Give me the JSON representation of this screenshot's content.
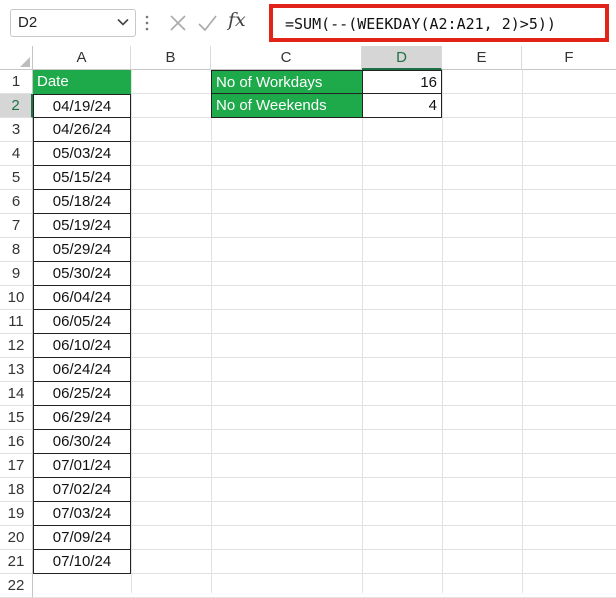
{
  "formula_bar": {
    "name_box": "D2",
    "fx_label": "fx",
    "formula": "=SUM(--(WEEKDAY(A2:A21, 2)>5))"
  },
  "columns": [
    "A",
    "B",
    "C",
    "D",
    "E",
    "F"
  ],
  "selected_column": "D",
  "rows": [
    "1",
    "2",
    "3",
    "4",
    "5",
    "6",
    "7",
    "8",
    "9",
    "10",
    "11",
    "12",
    "13",
    "14",
    "15",
    "16",
    "17",
    "18",
    "19",
    "20",
    "21",
    "22"
  ],
  "selected_row": "2",
  "column_a": {
    "header": "Date",
    "dates": [
      "04/19/24",
      "04/26/24",
      "05/03/24",
      "05/15/24",
      "05/18/24",
      "05/19/24",
      "05/29/24",
      "05/30/24",
      "06/04/24",
      "06/05/24",
      "06/10/24",
      "06/24/24",
      "06/25/24",
      "06/29/24",
      "06/30/24",
      "07/01/24",
      "07/02/24",
      "07/03/24",
      "07/09/24",
      "07/10/24"
    ]
  },
  "summary": [
    {
      "label": "No of Workdays",
      "value": "16"
    },
    {
      "label": "No of Weekends",
      "value": "4"
    }
  ],
  "colors": {
    "header_fill": "#1ea94b",
    "highlight_border": "#e2231a",
    "selection": "#1e7145"
  },
  "icons": [
    "chevron-down-icon",
    "cancel-icon",
    "enter-icon",
    "function-icon"
  ]
}
